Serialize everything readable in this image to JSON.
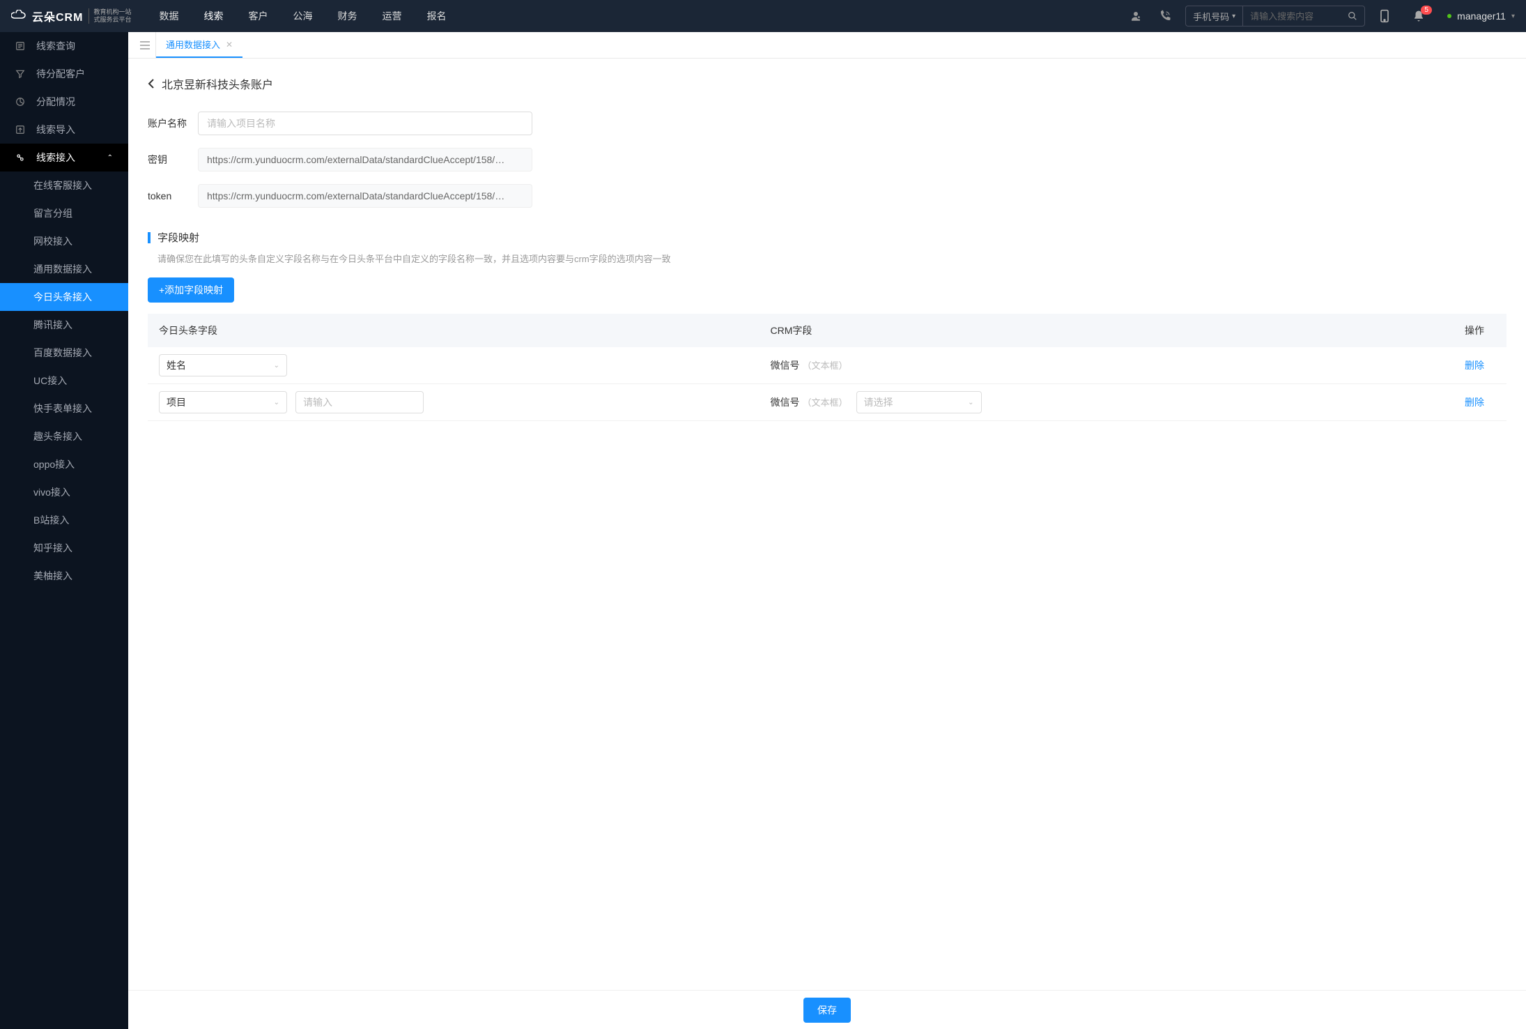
{
  "brand": {
    "name": "云朵CRM",
    "sub1": "教育机构一站",
    "sub2": "式服务云平台",
    "host": "www.yunduocrm.com"
  },
  "topnav": [
    "数据",
    "线索",
    "客户",
    "公海",
    "财务",
    "运营",
    "报名"
  ],
  "topnav_active": 1,
  "search": {
    "type": "手机号码",
    "placeholder": "请输入搜索内容"
  },
  "notification_count": "5",
  "user": "manager11",
  "sidebar": {
    "items": [
      {
        "label": "线索查询",
        "icon": "list"
      },
      {
        "label": "待分配客户",
        "icon": "filter"
      },
      {
        "label": "分配情况",
        "icon": "pie"
      },
      {
        "label": "线索导入",
        "icon": "upload"
      },
      {
        "label": "线索接入",
        "icon": "plug",
        "expanded": true,
        "children": [
          "在线客服接入",
          "留言分组",
          "网校接入",
          "通用数据接入",
          "今日头条接入",
          "腾讯接入",
          "百度数据接入",
          "UC接入",
          "快手表单接入",
          "趣头条接入",
          "oppo接入",
          "vivo接入",
          "B站接入",
          "知乎接入",
          "美柚接入"
        ],
        "active_child": 4
      }
    ]
  },
  "tabs": [
    {
      "label": "通用数据接入",
      "closable": true
    }
  ],
  "page": {
    "title": "北京昱新科技头条账户",
    "form": {
      "account_label": "账户名称",
      "account_placeholder": "请输入项目名称",
      "secret_label": "密钥",
      "secret_value": "https://crm.yunduocrm.com/externalData/standardClueAccept/158/…",
      "token_label": "token",
      "token_value": "https://crm.yunduocrm.com/externalData/standardClueAccept/158/…"
    },
    "mapping": {
      "title": "字段映射",
      "desc": "请确保您在此填写的头条自定义字段名称与在今日头条平台中自定义的字段名称一致，并且选项内容要与crm字段的选项内容一致",
      "add_btn": "+添加字段映射",
      "columns": [
        "今日头条字段",
        "CRM字段",
        "操作"
      ],
      "rows": [
        {
          "tt_field": "姓名",
          "extra_input": null,
          "crm_field": "微信号",
          "crm_hint": "（文本框）",
          "crm_select": null,
          "del": "删除"
        },
        {
          "tt_field": "项目",
          "extra_placeholder": "请输入",
          "crm_field": "微信号",
          "crm_hint": "（文本框）",
          "crm_select_placeholder": "请选择",
          "del": "删除"
        }
      ]
    },
    "save": "保存"
  }
}
